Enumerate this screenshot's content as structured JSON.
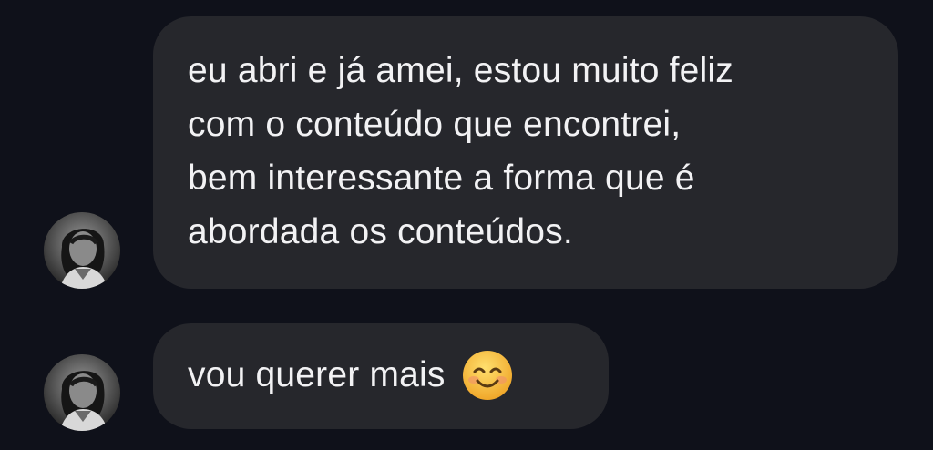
{
  "messages": [
    {
      "sender": "contact",
      "lines": [
        "eu abri e já amei, estou muito feliz",
        "com o conteúdo que encontrei,",
        "bem interessante a forma que é",
        "abordada os conteúdos."
      ]
    },
    {
      "sender": "contact",
      "text": "vou querer mais",
      "emoji_icon": "smiling-face-emoji-icon"
    }
  ],
  "colors": {
    "background": "#0f111a",
    "bubble": "#26272c",
    "text": "#f2f2f4",
    "emoji": "#f6c03a"
  }
}
